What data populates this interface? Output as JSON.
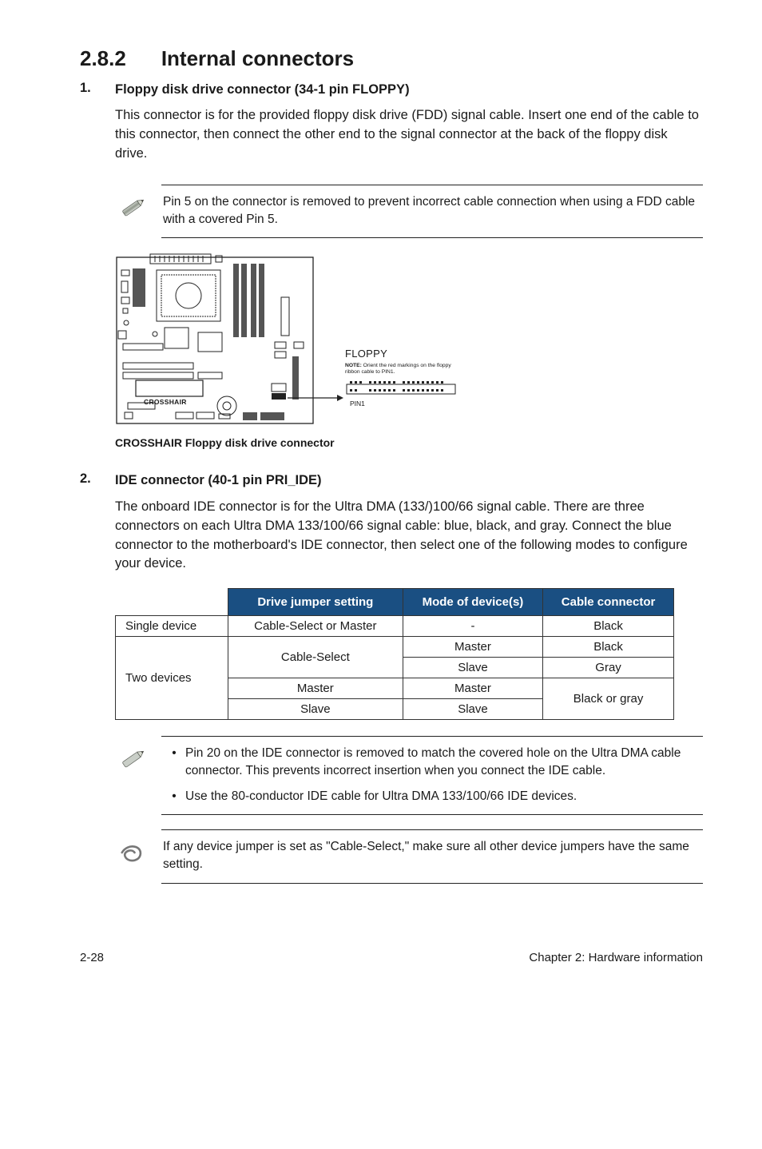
{
  "section": {
    "number": "2.8.2",
    "title": "Internal connectors"
  },
  "items": [
    {
      "num": "1.",
      "title": "Floppy disk drive connector (34-1 pin FLOPPY)",
      "body": "This connector is for the provided floppy disk drive (FDD) signal cable. Insert one end of the cable to this connector, then connect the other end to the signal connector at the back of the floppy disk drive.",
      "note": "Pin 5 on the connector is removed to prevent incorrect cable connection when using a FDD cable with a covered Pin 5.",
      "figure": {
        "board_label": "CROSSHAIR",
        "connector_title": "FLOPPY",
        "connector_note_label": "NOTE:",
        "connector_note_text": "Orient the red markings on the floppy ribbon cable to PIN1.",
        "pin_label": "PIN1",
        "caption": "CROSSHAIR Floppy disk drive connector"
      }
    },
    {
      "num": "2.",
      "title": "IDE connector (40-1 pin PRI_IDE)",
      "body": "The onboard IDE connector is for the Ultra DMA (133/)100/66 signal cable. There are three connectors on each Ultra DMA 133/100/66 signal cable: blue, black, and gray. Connect the blue connector to the motherboard's IDE connector, then select one of the following modes to configure your device."
    }
  ],
  "table": {
    "headers": {
      "c0": "",
      "c1": "Drive jumper setting",
      "c2": "Mode of device(s)",
      "c3": "Cable connector"
    },
    "rows": {
      "single_label": "Single device",
      "single_jumper": "Cable-Select or Master",
      "single_mode": "-",
      "single_conn": "Black",
      "two_label": "Two devices",
      "two_cs_label": "Cable-Select",
      "two_cs_master_mode": "Master",
      "two_cs_master_conn": "Black",
      "two_cs_slave_mode": "Slave",
      "two_cs_slave_conn": "Gray",
      "two_m_label": "Master",
      "two_m_mode": "Master",
      "two_s_label": "Slave",
      "two_s_mode": "Slave",
      "two_ms_conn": "Black or gray"
    }
  },
  "notes_after_table": {
    "a": "Pin 20 on the IDE connector is removed to match the covered hole on the Ultra DMA cable connector. This prevents incorrect insertion when you connect the IDE cable.",
    "b": "Use the 80-conductor IDE cable for Ultra DMA 133/100/66 IDE devices."
  },
  "important_note": "If any device jumper is set as \"Cable-Select,\" make sure all other device jumpers have the same setting.",
  "footer": {
    "left": "2-28",
    "right": "Chapter 2: Hardware information"
  }
}
